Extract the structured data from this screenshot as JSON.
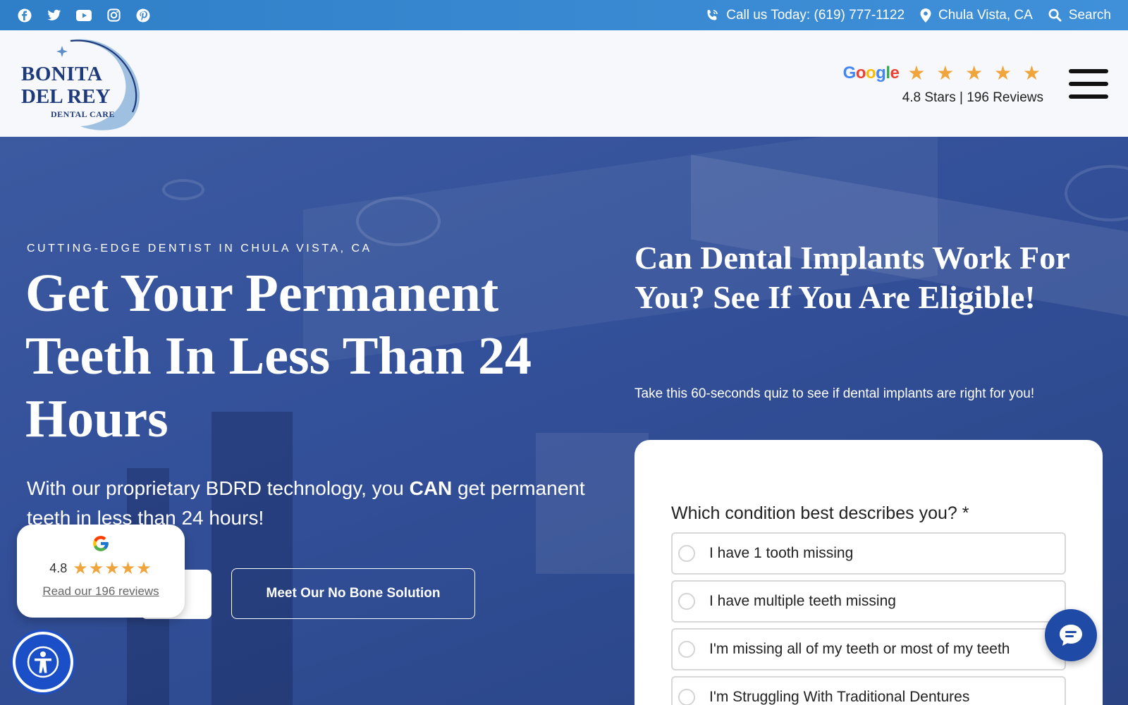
{
  "topbar": {
    "social": [
      "facebook-icon",
      "twitter-icon",
      "youtube-icon",
      "instagram-icon",
      "pinterest-icon"
    ],
    "phone_label": "Call us Today: (619) 777-1122",
    "location_label": "Chula Vista, CA",
    "search_label": "Search"
  },
  "header": {
    "logo": {
      "line1": "BONITA",
      "line2": "DEL REY",
      "line3": "DENTAL CARE"
    },
    "google_word": "Google",
    "stars": "★ ★ ★ ★ ★",
    "rating_text": "4.8 Stars | 196 Reviews"
  },
  "hero": {
    "overline": "CUTTING-EDGE DENTIST IN CHULA VISTA, CA",
    "headline": "Get Your Permanent Teeth In Less Than 24 Hours",
    "sub_before": "With our proprietary BDRD technology, you ",
    "sub_bold": "CAN",
    "sub_after": " get permanent teeth in less than 24 hours!",
    "button_label": "Meet Our No Bone Solution"
  },
  "quiz": {
    "title": "Can Dental Implants Work For You? See If You Are Eligible!",
    "subtitle": "Take this 60-seconds quiz to see if dental implants are right for you!",
    "question": "Which condition best describes you? *",
    "options": [
      "I have 1 tooth missing",
      "I have multiple teeth missing",
      "I'm missing all of my teeth or most of my teeth",
      "I'm Struggling With Traditional Dentures"
    ]
  },
  "review_widget": {
    "rating": "4.8",
    "stars": "★★★★★",
    "link": "Read our 196 reviews"
  },
  "colors": {
    "topbar": "#3a8ad3",
    "hero": "#33509a",
    "star": "#f0a43c",
    "brand": "#1e3a7a"
  }
}
